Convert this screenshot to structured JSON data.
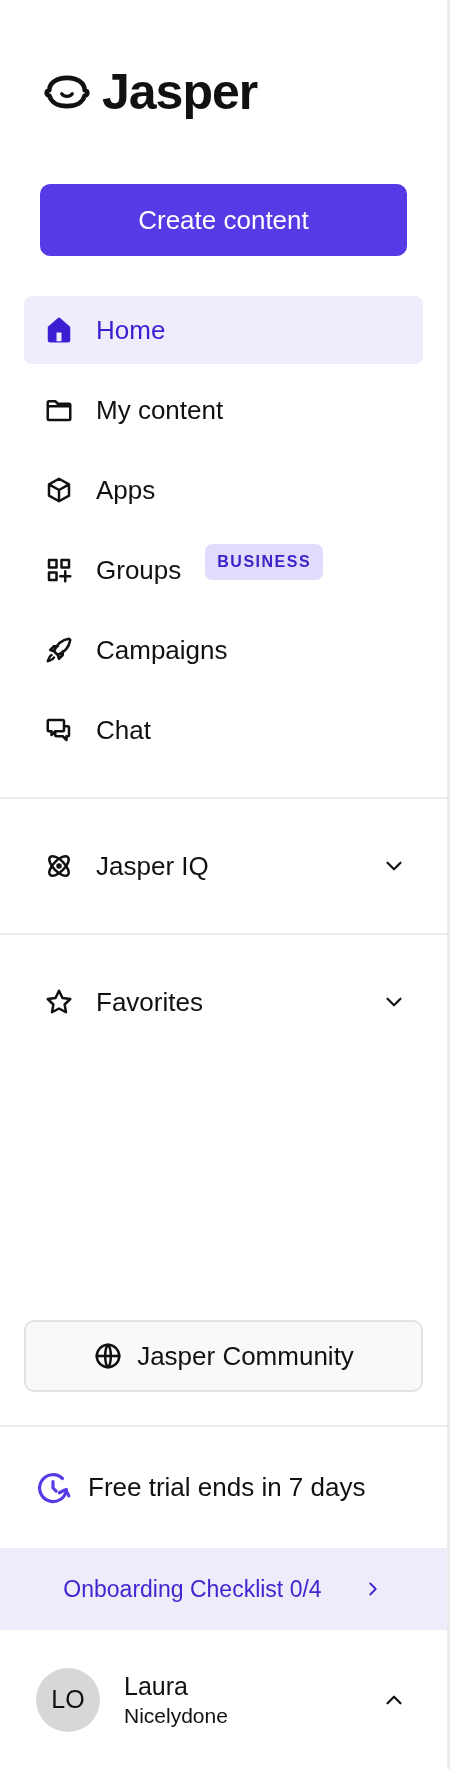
{
  "logo": {
    "text": "Jasper"
  },
  "create_button": {
    "label": "Create content"
  },
  "nav": [
    {
      "label": "Home",
      "selected": true
    },
    {
      "label": "My content",
      "selected": false
    },
    {
      "label": "Apps",
      "selected": false
    },
    {
      "label": "Groups",
      "badge": "BUSINESS",
      "selected": false
    },
    {
      "label": "Campaigns",
      "selected": false
    },
    {
      "label": "Chat",
      "selected": false
    }
  ],
  "sections": [
    {
      "label": "Jasper IQ",
      "expanded": false
    },
    {
      "label": "Favorites",
      "expanded": false
    }
  ],
  "community_button": {
    "label": "Jasper Community"
  },
  "trial": {
    "text": "Free trial ends in 7 days"
  },
  "onboarding": {
    "label": "Onboarding Checklist 0/4"
  },
  "user": {
    "initials": "LO",
    "first_name": "Laura",
    "last_name": "Nicelydone"
  }
}
